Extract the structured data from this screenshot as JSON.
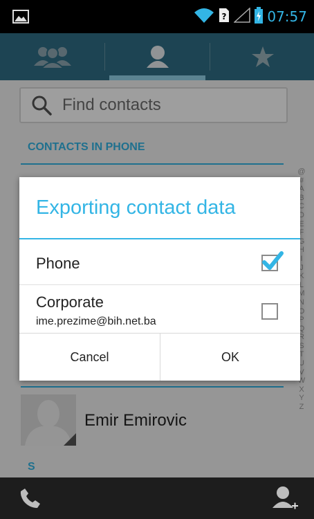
{
  "status_bar": {
    "time": "07:57",
    "icons": [
      "gallery-thumbnail-icon",
      "wifi-icon",
      "sim-unknown-icon",
      "signal-icon",
      "battery-charging-icon"
    ],
    "accent": "#33b5e5"
  },
  "tabs": [
    {
      "icon": "groups-icon",
      "selected": false
    },
    {
      "icon": "contacts-icon",
      "selected": true
    },
    {
      "icon": "favorites-star-icon",
      "selected": false
    }
  ],
  "search": {
    "placeholder": "Find contacts"
  },
  "section_header": "CONTACTS IN PHONE",
  "index_letters": [
    "@",
    "#",
    "A",
    "B",
    "C",
    "D",
    "E",
    "F",
    "G",
    "H",
    "I",
    "J",
    "K",
    "L",
    "M",
    "N",
    "O",
    "P",
    "Q",
    "R",
    "S",
    "T",
    "U",
    "V",
    "W",
    "X",
    "Y",
    "Z"
  ],
  "contacts": [
    {
      "name": "Emir Emirovic"
    }
  ],
  "next_section_letter": "S",
  "dialog": {
    "title": "Exporting contact data",
    "options": [
      {
        "label": "Phone",
        "sublabel": "",
        "checked": true
      },
      {
        "label": "Corporate",
        "sublabel": "ime.prezime@bih.net.ba",
        "checked": false
      }
    ],
    "cancel_label": "Cancel",
    "ok_label": "OK"
  },
  "bottom_bar": {
    "left_icon": "phone-icon",
    "right_icon": "add-contact-icon"
  }
}
